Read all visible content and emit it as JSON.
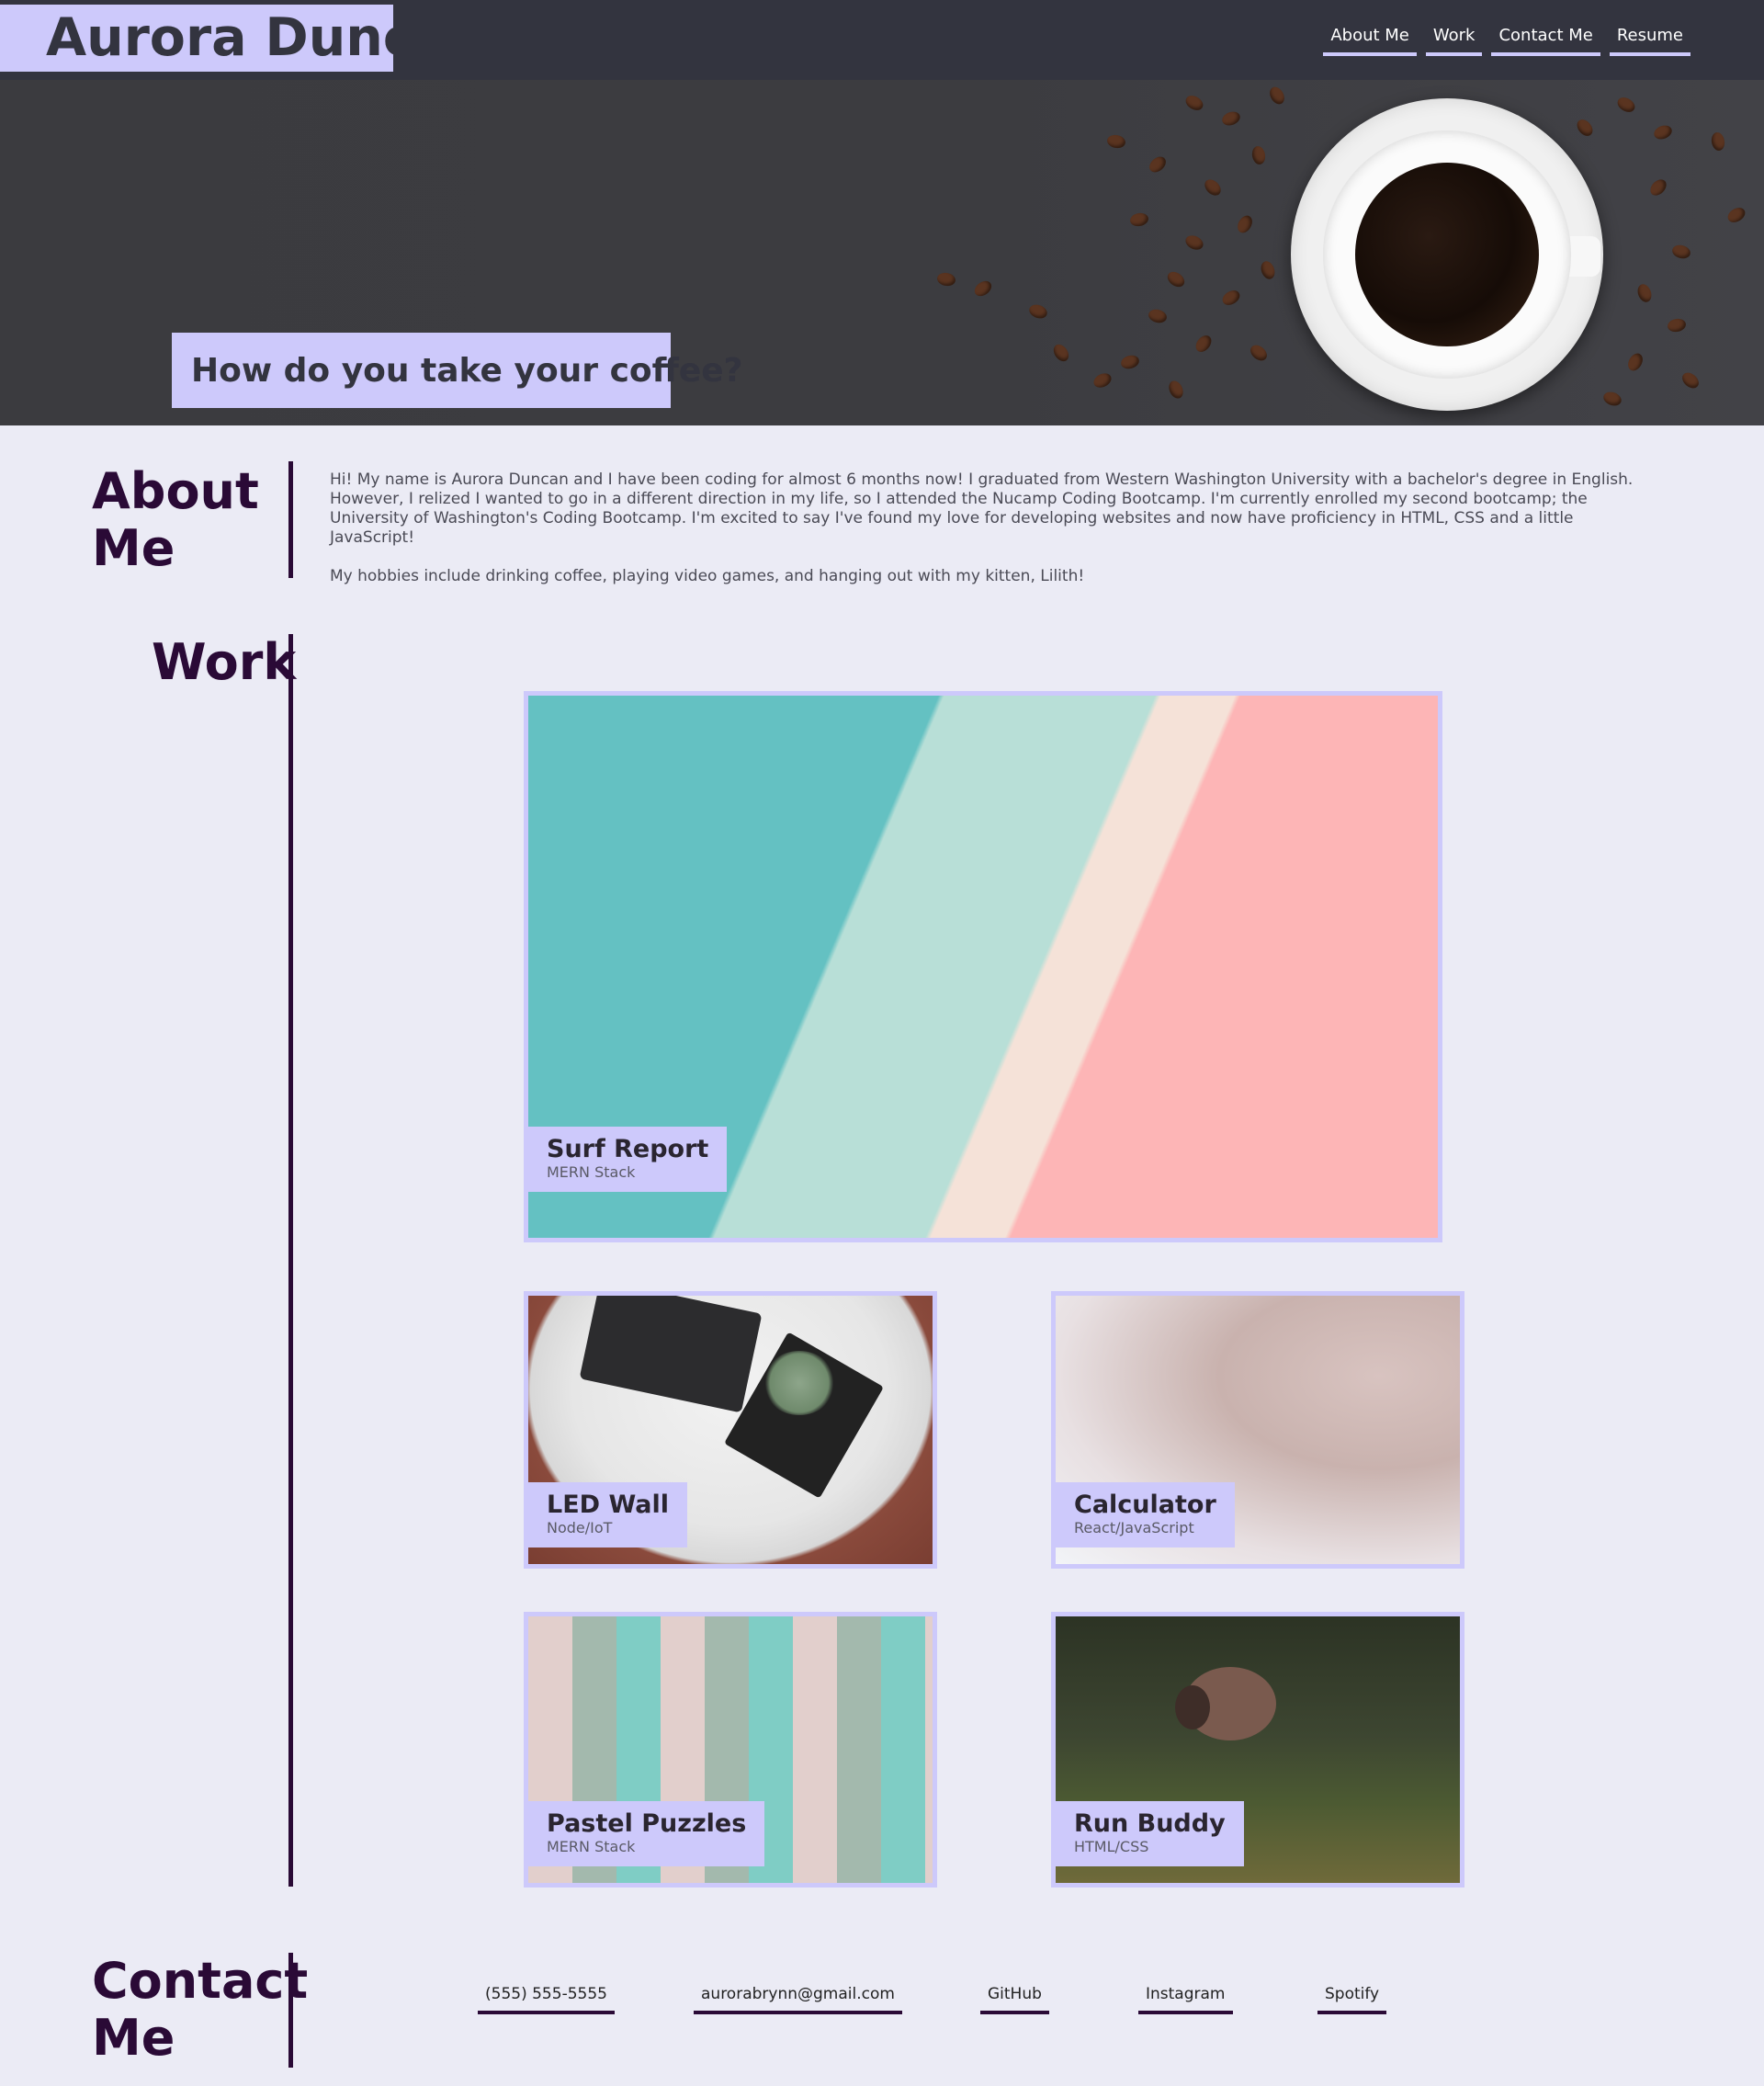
{
  "header": {
    "brand": "Aurora Duncan",
    "nav": [
      "About Me",
      "Work",
      "Contact Me",
      "Resume"
    ]
  },
  "hero": {
    "tagline": "How do you take your coffee?"
  },
  "about": {
    "title_line1": "About",
    "title_line2": "Me",
    "paragraph1": "Hi! My name is Aurora Duncan and I have been coding for almost 6 months now! I graduated from Western Washington University with a bachelor's degree in English. However, I relized I wanted to go in a different direction in my life, so I attended the Nucamp Coding Bootcamp. I'm currently enrolled my second bootcamp; the University of Washington's Coding Bootcamp. I'm excited to say I've found my love for developing websites and now have proficiency in HTML, CSS and a little JavaScript!",
    "paragraph2": "My hobbies include drinking coffee, playing video games, and hanging out with my kitten, Lilith!"
  },
  "work": {
    "title": "Work",
    "projects": [
      {
        "title": "Surf Report",
        "stack": "MERN Stack"
      },
      {
        "title": "LED Wall",
        "stack": "Node/IoT"
      },
      {
        "title": "Calculator",
        "stack": "React/JavaScript"
      },
      {
        "title": "Pastel Puzzles",
        "stack": "MERN Stack"
      },
      {
        "title": "Run Buddy",
        "stack": "HTML/CSS"
      }
    ]
  },
  "contact": {
    "title_line1": "Contact",
    "title_line2": "Me",
    "links": [
      "(555) 555-5555",
      "aurorabrynn@gmail.com",
      "GitHub",
      "Instagram",
      "Spotify"
    ]
  },
  "colors": {
    "header_bg": "#33343f",
    "accent": "#cdc9fb",
    "page_bg": "#ebebf5",
    "heading": "#2a0a36"
  }
}
